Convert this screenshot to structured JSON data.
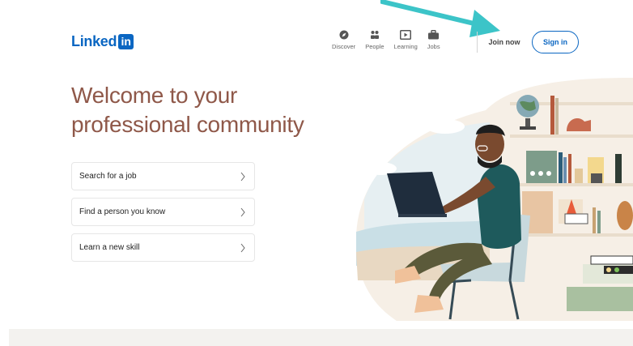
{
  "brand": {
    "logo_text": "Linked",
    "logo_box": "in"
  },
  "nav": {
    "items": [
      {
        "label": "Discover",
        "icon": "compass-icon"
      },
      {
        "label": "People",
        "icon": "people-icon"
      },
      {
        "label": "Learning",
        "icon": "play-icon"
      },
      {
        "label": "Jobs",
        "icon": "briefcase-icon"
      }
    ],
    "join_label": "Join now",
    "signin_label": "Sign in"
  },
  "hero": {
    "title_line1": "Welcome to your",
    "title_line2": "professional community",
    "ctas": [
      {
        "label": "Search for a job"
      },
      {
        "label": "Find a person you know"
      },
      {
        "label": "Learn a new skill"
      }
    ]
  },
  "colors": {
    "brand_blue": "#0a66c2",
    "headline": "#8f5849",
    "annotation_arrow": "#3cc4c8",
    "footer_band": "#f3f2ef"
  }
}
